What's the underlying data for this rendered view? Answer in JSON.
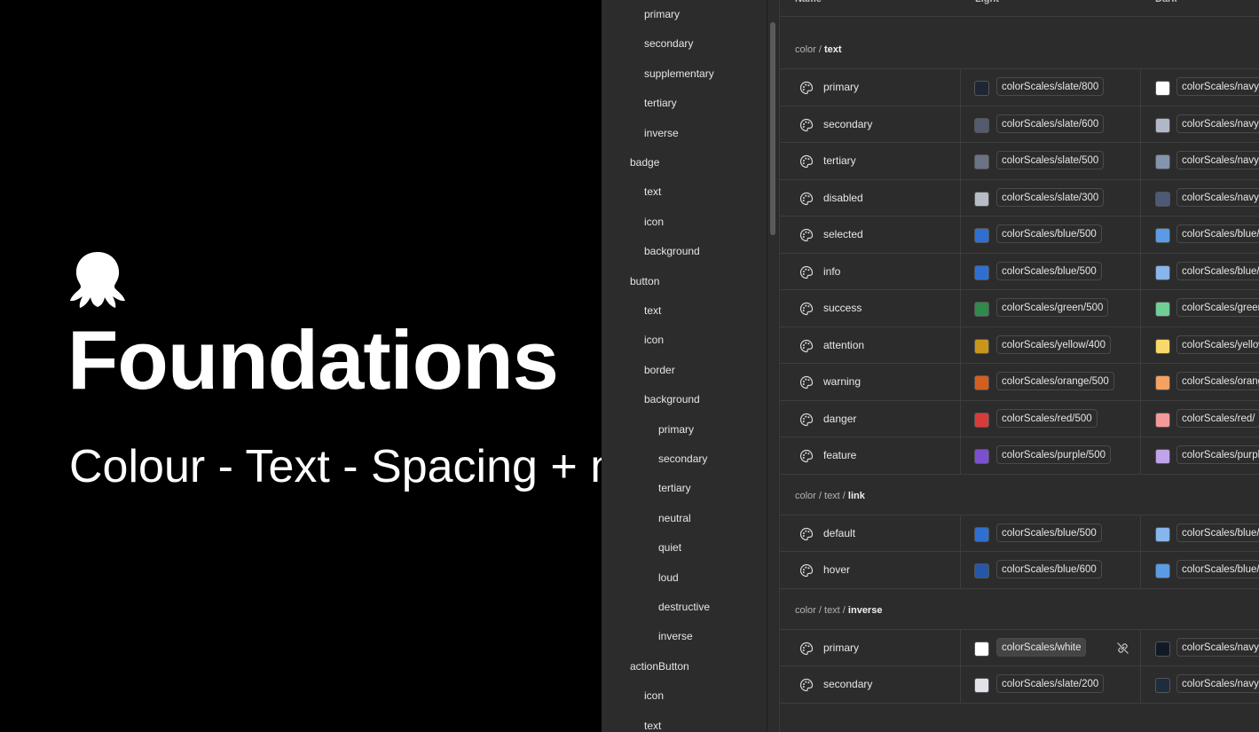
{
  "hero": {
    "title": "Foundations",
    "subtitle": "Colour - Text - Spacing + m"
  },
  "tree": [
    {
      "label": "primary",
      "depth": 1
    },
    {
      "label": "secondary",
      "depth": 1
    },
    {
      "label": "supplementary",
      "depth": 1
    },
    {
      "label": "tertiary",
      "depth": 1
    },
    {
      "label": "inverse",
      "depth": 1
    },
    {
      "label": "badge",
      "depth": 0
    },
    {
      "label": "text",
      "depth": 1
    },
    {
      "label": "icon",
      "depth": 1
    },
    {
      "label": "background",
      "depth": 1
    },
    {
      "label": "button",
      "depth": 0
    },
    {
      "label": "text",
      "depth": 1
    },
    {
      "label": "icon",
      "depth": 1
    },
    {
      "label": "border",
      "depth": 1
    },
    {
      "label": "background",
      "depth": 1
    },
    {
      "label": "primary",
      "depth": 2
    },
    {
      "label": "secondary",
      "depth": 2
    },
    {
      "label": "tertiary",
      "depth": 2
    },
    {
      "label": "neutral",
      "depth": 2
    },
    {
      "label": "quiet",
      "depth": 2
    },
    {
      "label": "loud",
      "depth": 2
    },
    {
      "label": "destructive",
      "depth": 2
    },
    {
      "label": "inverse",
      "depth": 2
    },
    {
      "label": "actionButton",
      "depth": 0
    },
    {
      "label": "icon",
      "depth": 1
    },
    {
      "label": "text",
      "depth": 1
    }
  ],
  "table": {
    "headers": {
      "name": "Name",
      "light": "Light",
      "dark": "Dark"
    },
    "groups": [
      {
        "prefix": "color / ",
        "leaf": "text",
        "rows": [
          {
            "name": "primary",
            "light": "colorScales/slate/800",
            "light_color": "#1f2533",
            "dark": "colorScales/navy/",
            "dark_color": "#ffffff"
          },
          {
            "name": "secondary",
            "light": "colorScales/slate/600",
            "light_color": "#545b6e",
            "dark": "colorScales/navy/",
            "dark_color": "#b0b8c8"
          },
          {
            "name": "tertiary",
            "light": "colorScales/slate/500",
            "light_color": "#6b7386",
            "dark": "colorScales/navy/",
            "dark_color": "#8594ad"
          },
          {
            "name": "disabled",
            "light": "colorScales/slate/300",
            "light_color": "#b8bcc6",
            "dark": "colorScales/navy/",
            "dark_color": "#4a5a78"
          },
          {
            "name": "selected",
            "light": "colorScales/blue/500",
            "light_color": "#2f6fd1",
            "dark": "colorScales/blue/",
            "dark_color": "#5b9be6"
          },
          {
            "name": "info",
            "light": "colorScales/blue/500",
            "light_color": "#2f6fd1",
            "dark": "colorScales/blue/",
            "dark_color": "#86b6ec"
          },
          {
            "name": "success",
            "light": "colorScales/green/500",
            "light_color": "#2f8a4c",
            "dark": "colorScales/green/",
            "dark_color": "#6fcf97"
          },
          {
            "name": "attention",
            "light": "colorScales/yellow/400",
            "light_color": "#c9951a",
            "dark": "colorScales/yellow/",
            "dark_color": "#f8d86a"
          },
          {
            "name": "warning",
            "light": "colorScales/orange/500",
            "light_color": "#d35f1e",
            "dark": "colorScales/orange/",
            "dark_color": "#f4a261"
          },
          {
            "name": "danger",
            "light": "colorScales/red/500",
            "light_color": "#d93b3b",
            "dark": "colorScales/red/",
            "dark_color": "#f29a9a"
          },
          {
            "name": "feature",
            "light": "colorScales/purple/500",
            "light_color": "#7c4fd1",
            "dark": "colorScales/purple/",
            "dark_color": "#c0a3ea"
          }
        ]
      },
      {
        "prefix": "color / text / ",
        "leaf": "link",
        "rows": [
          {
            "name": "default",
            "light": "colorScales/blue/500",
            "light_color": "#2f6fd1",
            "dark": "colorScales/blue/",
            "dark_color": "#86b6ec"
          },
          {
            "name": "hover",
            "light": "colorScales/blue/600",
            "light_color": "#2556a8",
            "dark": "colorScales/blue/",
            "dark_color": "#5b9be6"
          }
        ]
      },
      {
        "prefix": "color / text / ",
        "leaf": "inverse",
        "rows": [
          {
            "name": "primary",
            "light": "colorScales/white",
            "light_color": "#ffffff",
            "dark": "colorScales/navy/",
            "dark_color": "#111a24",
            "highlight": true
          },
          {
            "name": "secondary",
            "light": "colorScales/slate/200",
            "light_color": "#e1e3e8",
            "dark": "colorScales/navy/",
            "dark_color": "#1e2d3d"
          }
        ]
      }
    ]
  },
  "colors": {
    "panel_bg": "#2c2c2c",
    "hero_bg": "#000000",
    "border": "#3d3d3d"
  },
  "icons": {
    "logo": "octopus-logo",
    "row": "palette-icon",
    "detach": "unlink-icon"
  }
}
